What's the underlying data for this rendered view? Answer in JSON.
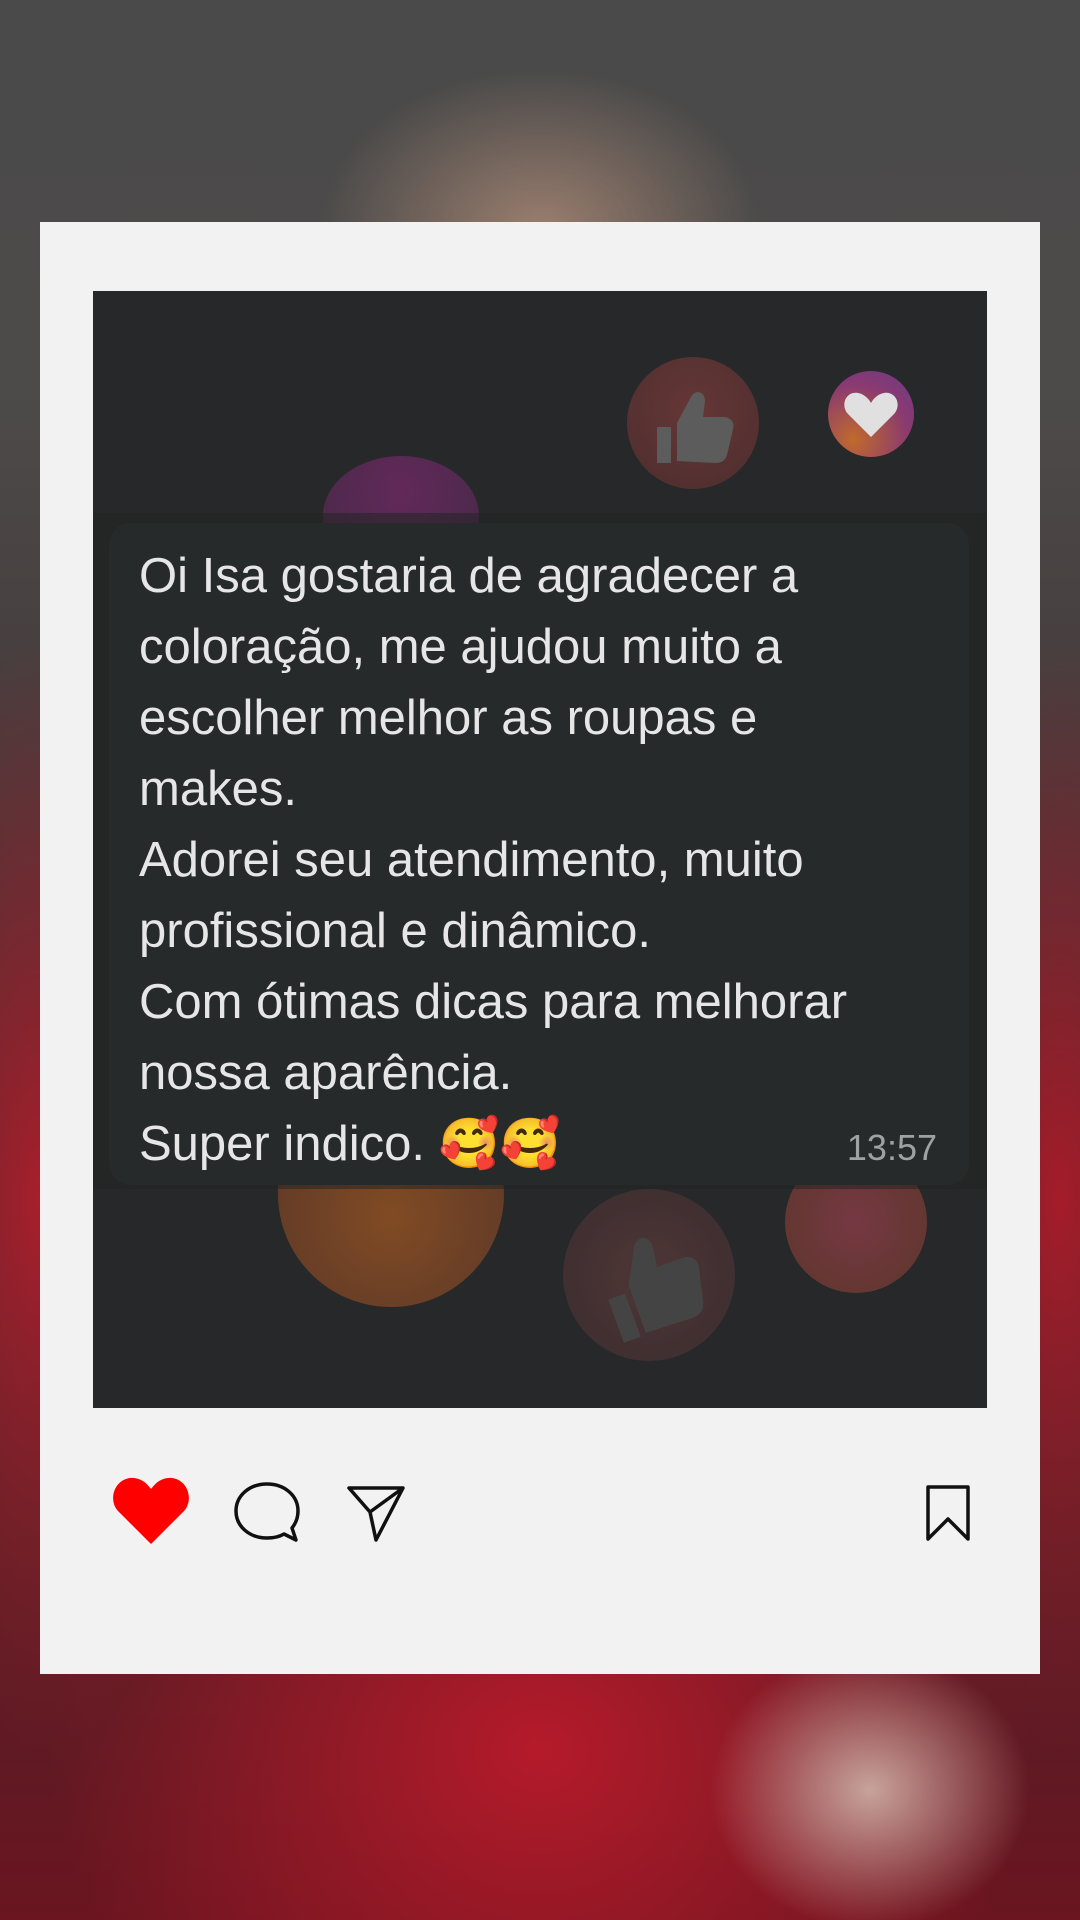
{
  "post": {
    "message": {
      "text": "Oi Isa gostaria de agradecer a\ncoloração, me ajudou muito a\nescolher melhor as roupas e\nmakes.\nAdorei seu atendimento, muito\nprofissional e dinâmico.\nCom ótimas dicas para melhorar\nnossa aparência.\nSuper indico. 🥰🥰",
      "time": "13:57"
    },
    "reaction_icons": [
      "thumbs-up-icon",
      "heart-icon"
    ]
  },
  "actions": {
    "like": {
      "icon": "heart-icon",
      "state": "liked",
      "color": "#ff0000"
    },
    "comment": {
      "icon": "comment-icon"
    },
    "share": {
      "icon": "send-icon"
    },
    "save": {
      "icon": "bookmark-icon"
    }
  }
}
